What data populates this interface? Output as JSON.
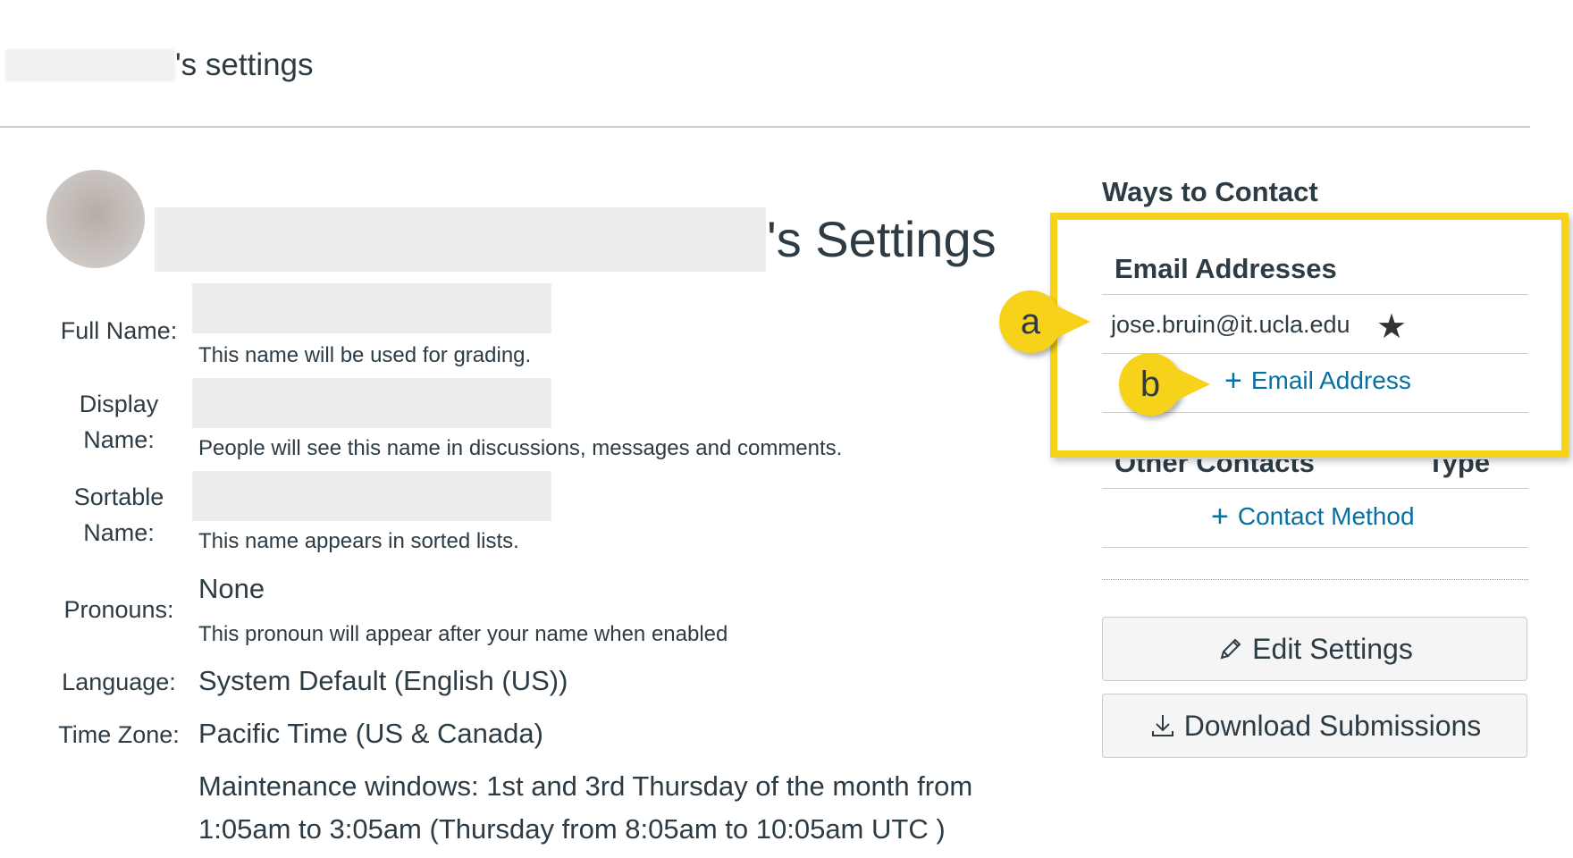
{
  "breadcrumb": {
    "suffix": "'s settings"
  },
  "profile": {
    "title_suffix": "'s Settings"
  },
  "fields": {
    "full_name": {
      "label": "Full Name:",
      "help": "This name will be used for grading."
    },
    "display_name": {
      "label_1": "Display",
      "label_2": "Name:",
      "help": "People will see this name in discussions, messages and comments."
    },
    "sortable_name": {
      "label_1": "Sortable",
      "label_2": "Name:",
      "help": "This name appears in sorted lists."
    },
    "pronouns": {
      "label": "Pronouns:",
      "value": "None",
      "help": "This pronoun will appear after your name when enabled"
    },
    "language": {
      "label": "Language:",
      "value": "System Default (English (US))"
    },
    "time_zone": {
      "label": "Time Zone:",
      "value": "Pacific Time (US & Canada)",
      "maintenance_1": "Maintenance windows: 1st and 3rd Thursday of the month from",
      "maintenance_2": "1:05am to 3:05am (Thursday from 8:05am to 10:05am UTC )"
    }
  },
  "contact": {
    "heading": "Ways to Contact",
    "email_heading": "Email Addresses",
    "email": "jose.bruin@it.ucla.edu",
    "add_email": "Email Address",
    "other_heading": "Other Contacts",
    "type_heading": "Type",
    "add_contact": "Contact Method"
  },
  "buttons": {
    "edit": "Edit Settings",
    "download": "Download Submissions"
  },
  "callouts": {
    "a": "a",
    "b": "b"
  },
  "colors": {
    "highlight": "#f6d31a",
    "link": "#0770a3",
    "text": "#2d3b45"
  }
}
